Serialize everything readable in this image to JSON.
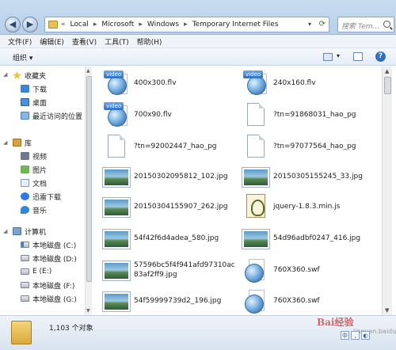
{
  "window": {
    "breadcrumbs": [
      "Local",
      "Microsoft",
      "Windows",
      "Temporary Internet Files"
    ],
    "search_placeholder": "搜索 Tem..."
  },
  "menu": [
    "文件(F)",
    "编辑(E)",
    "查看(V)",
    "工具(T)",
    "帮助(H)"
  ],
  "toolbar": {
    "organize_label": "组织 ▾"
  },
  "navigation": {
    "favorites": {
      "label": "收藏夹",
      "items": [
        "下载",
        "桌面",
        "最近访问的位置"
      ]
    },
    "libraries": {
      "label": "库",
      "items": [
        "视频",
        "图片",
        "文档",
        "迅雷下载",
        "音乐"
      ]
    },
    "computer": {
      "label": "计算机",
      "items": [
        "本地磁盘 (C:)",
        "本地磁盘 (D:)",
        "E (E:)",
        "本地磁盘 (F:)",
        "本地磁盘 (G:)"
      ]
    }
  },
  "files": [
    {
      "name": "400x300.flv",
      "type": "video",
      "icon_tag": "video"
    },
    {
      "name": "240x160.flv",
      "type": "video",
      "icon_tag": "video"
    },
    {
      "name": "700x90.flv",
      "type": "video",
      "icon_tag": "video"
    },
    {
      "name": "?tn=91868031_hao_pg",
      "type": "blank"
    },
    {
      "name": "?tn=92002447_hao_pg",
      "type": "blank"
    },
    {
      "name": "?tn=97077564_hao_pg",
      "type": "blank"
    },
    {
      "name": "20150302095812_102.jpg",
      "type": "image"
    },
    {
      "name": "20150305155245_33.jpg",
      "type": "image"
    },
    {
      "name": "20150304155907_262.jpg",
      "type": "image"
    },
    {
      "name": "jquery-1.8.3.min.js",
      "type": "js"
    },
    {
      "name": "54f42f6d4adea_580.jpg",
      "type": "image"
    },
    {
      "name": "54d96adbf0247_416.jpg",
      "type": "image"
    },
    {
      "name": "57596bc5f4f941afd97310ac83af2ff9.jpg",
      "type": "image"
    },
    {
      "name": "760X360.swf",
      "type": "swf"
    },
    {
      "name": "54f59999739d2_196.jpg",
      "type": "image"
    },
    {
      "name": "760X360.swf",
      "type": "swf"
    }
  ],
  "status": {
    "count": "1,103 个对象"
  },
  "watermark": {
    "brand": "Bai经验",
    "sub": "jingyan.baidu.com"
  }
}
